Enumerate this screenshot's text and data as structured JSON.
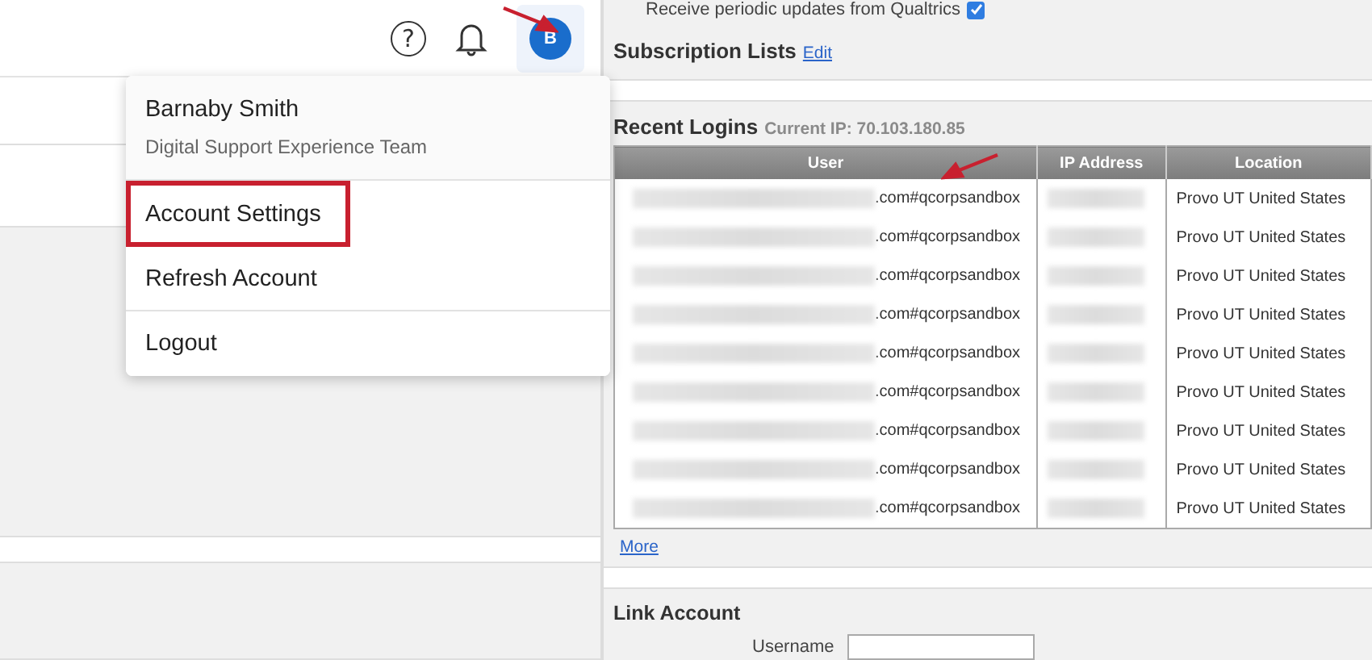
{
  "header": {
    "help": "?",
    "avatar_initial": "B"
  },
  "account_menu": {
    "name": "Barnaby Smith",
    "team": "Digital Support Experience Team",
    "items": [
      {
        "label": "Account Settings",
        "highlighted": true
      },
      {
        "label": "Refresh Account",
        "highlighted": false
      },
      {
        "label": "Logout",
        "highlighted": false
      }
    ]
  },
  "updates": {
    "label": "Receive periodic updates from Qualtrics",
    "checked": true
  },
  "subscription": {
    "title": "Subscription Lists",
    "link": "Edit"
  },
  "recent_logins": {
    "title": "Recent Logins",
    "current_ip": "Current IP: 70.103.180.85",
    "columns": [
      "User",
      "IP Address",
      "Location"
    ],
    "rows": [
      {
        "user": ".com#qcorpsandbox",
        "redacted": true,
        "location": "Provo UT United States"
      },
      {
        "user": ".com#qcorpsandbox",
        "redacted": true,
        "location": "Provo UT United States"
      },
      {
        "user": ".com#qcorpsandbox",
        "redacted": true,
        "location": "Provo UT United States"
      },
      {
        "user": ".com#qcorpsandbox",
        "redacted": true,
        "location": "Provo UT United States"
      },
      {
        "user": ".com#qcorpsandbox",
        "redacted": true,
        "location": "Provo UT United States"
      },
      {
        "user": ".com#qcorpsandbox",
        "redacted": true,
        "location": "Provo UT United States"
      },
      {
        "user": ".com#qcorpsandbox",
        "redacted": true,
        "location": "Provo UT United States"
      },
      {
        "user": ".com#qcorpsandbox",
        "redacted": true,
        "location": "Provo UT United States"
      },
      {
        "user": ".com#qcorpsandbox",
        "redacted": true,
        "location": "Provo UT United States"
      }
    ],
    "more": "More"
  },
  "link_account": {
    "title": "Link Account",
    "field_label": "Username"
  }
}
